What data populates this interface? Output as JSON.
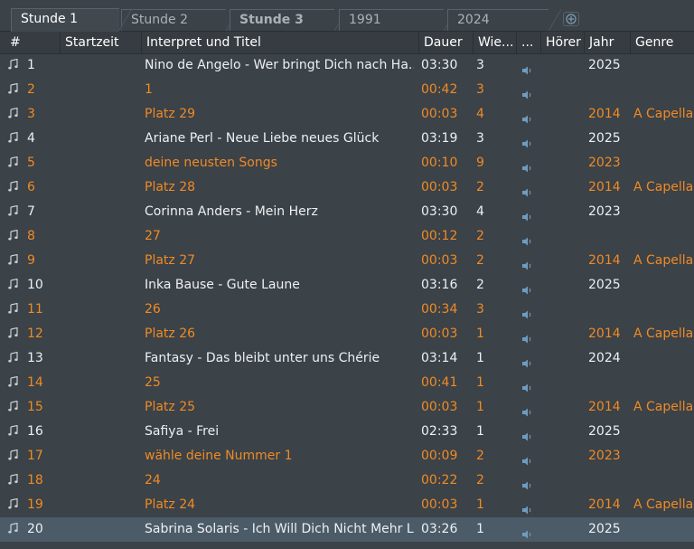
{
  "tabs": [
    {
      "label": "Stunde 1",
      "active": true,
      "bold": false
    },
    {
      "label": "Stunde 2",
      "active": false,
      "bold": false
    },
    {
      "label": "Stunde 3",
      "active": false,
      "bold": true
    },
    {
      "label": "1991",
      "active": false,
      "bold": false
    },
    {
      "label": "2024",
      "active": false,
      "bold": false
    }
  ],
  "add_tab_icon": "plus-circle-icon",
  "columns": {
    "num": "#",
    "start": "Startzeit",
    "title": "Interpret und Titel",
    "duration": "Dauer",
    "repeats": "Wie...",
    "more": "...",
    "listener": "Hörer",
    "year": "Jahr",
    "genre": "Genre"
  },
  "row_icon": "music-note-icon",
  "preview_icon": "speaker-icon",
  "colors": {
    "orange": "#f08a24",
    "normal": "#eef0f2",
    "background": "#3b4248",
    "selected": "#4b5b68"
  },
  "rows": [
    {
      "num": "1",
      "title": "Nino de Angelo - Wer bringt Dich nach Ha...",
      "duration": "03:30",
      "repeats": "3",
      "year": "2025",
      "genre": "",
      "style": "normal"
    },
    {
      "num": "2",
      "title": "1",
      "duration": "00:42",
      "repeats": "3",
      "year": "",
      "genre": "",
      "style": "orange"
    },
    {
      "num": "3",
      "title": "Platz 29",
      "duration": "00:03",
      "repeats": "4",
      "year": "2014",
      "genre": "A Capella",
      "style": "orange"
    },
    {
      "num": "4",
      "title": "Ariane Perl - Neue Liebe neues Glück",
      "duration": "03:19",
      "repeats": "3",
      "year": "2025",
      "genre": "",
      "style": "normal"
    },
    {
      "num": "5",
      "title": "deine neusten Songs",
      "duration": "00:10",
      "repeats": "9",
      "year": "2023",
      "genre": "",
      "style": "orange"
    },
    {
      "num": "6",
      "title": "Platz 28",
      "duration": "00:03",
      "repeats": "2",
      "year": "2014",
      "genre": "A Capella",
      "style": "orange"
    },
    {
      "num": "7",
      "title": "Corinna Anders - Mein Herz",
      "duration": "03:30",
      "repeats": "4",
      "year": "2023",
      "genre": "",
      "style": "normal"
    },
    {
      "num": "8",
      "title": "27",
      "duration": "00:12",
      "repeats": "2",
      "year": "",
      "genre": "",
      "style": "orange"
    },
    {
      "num": "9",
      "title": "Platz 27",
      "duration": "00:03",
      "repeats": "2",
      "year": "2014",
      "genre": "A Capella",
      "style": "orange"
    },
    {
      "num": "10",
      "title": "Inka Bause - Gute Laune",
      "duration": "03:16",
      "repeats": "2",
      "year": "2025",
      "genre": "",
      "style": "normal"
    },
    {
      "num": "11",
      "title": "26",
      "duration": "00:34",
      "repeats": "3",
      "year": "",
      "genre": "",
      "style": "orange"
    },
    {
      "num": "12",
      "title": "Platz 26",
      "duration": "00:03",
      "repeats": "1",
      "year": "2014",
      "genre": "A Capella",
      "style": "orange"
    },
    {
      "num": "13",
      "title": "Fantasy - Das bleibt unter uns Chérie",
      "duration": "03:14",
      "repeats": "1",
      "year": "2024",
      "genre": "",
      "style": "normal"
    },
    {
      "num": "14",
      "title": "25",
      "duration": "00:41",
      "repeats": "1",
      "year": "",
      "genre": "",
      "style": "orange"
    },
    {
      "num": "15",
      "title": "Platz 25",
      "duration": "00:03",
      "repeats": "1",
      "year": "2014",
      "genre": "A Capella",
      "style": "orange"
    },
    {
      "num": "16",
      "title": "Safiya - Frei",
      "duration": "02:33",
      "repeats": "1",
      "year": "2025",
      "genre": "",
      "style": "normal"
    },
    {
      "num": "17",
      "title": "wähle deine Nummer 1",
      "duration": "00:09",
      "repeats": "2",
      "year": "2023",
      "genre": "",
      "style": "orange"
    },
    {
      "num": "18",
      "title": "24",
      "duration": "00:22",
      "repeats": "2",
      "year": "",
      "genre": "",
      "style": "orange"
    },
    {
      "num": "19",
      "title": "Platz 24",
      "duration": "00:03",
      "repeats": "1",
      "year": "2014",
      "genre": "A Capella",
      "style": "orange"
    },
    {
      "num": "20",
      "title": "Sabrina Solaris - Ich Will Dich Nicht Mehr L...",
      "duration": "03:26",
      "repeats": "1",
      "year": "2025",
      "genre": "",
      "style": "normal",
      "selected": true
    }
  ]
}
